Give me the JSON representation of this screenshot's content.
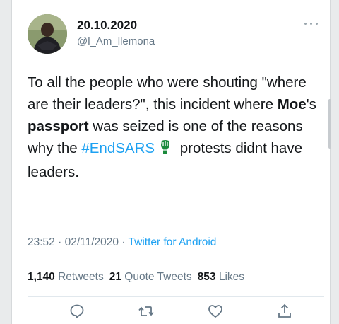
{
  "tweet": {
    "display_name": "20.10.2020",
    "handle": "@l_Am_llemona",
    "text": {
      "p1": "To all the people who were shouting \"where are their leaders?\", this incident where ",
      "bold1": "Moe",
      "p2": "'s ",
      "bold2": "passport",
      "p3": " was seized is one of the reasons why the ",
      "hashtag": "#EndSARS",
      "p4": " protests didnt have leaders."
    },
    "time": "23:52",
    "sep1": " · ",
    "date": "02/11/2020",
    "sep2": " · ",
    "source": "Twitter for Android",
    "stats": {
      "retweets_count": "1,140",
      "retweets_label": "Retweets",
      "quotes_count": "21",
      "quotes_label": "Quote Tweets",
      "likes_count": "853",
      "likes_label": "Likes"
    }
  },
  "icons": {
    "more": "more-options-icon",
    "emoji": "raised-fist-emoji-icon",
    "reply": "reply-icon",
    "retweet": "retweet-icon",
    "like": "heart-icon",
    "share": "share-icon"
  },
  "colors": {
    "accent": "#1da1f2",
    "text": "#14171a",
    "muted": "#657786"
  }
}
